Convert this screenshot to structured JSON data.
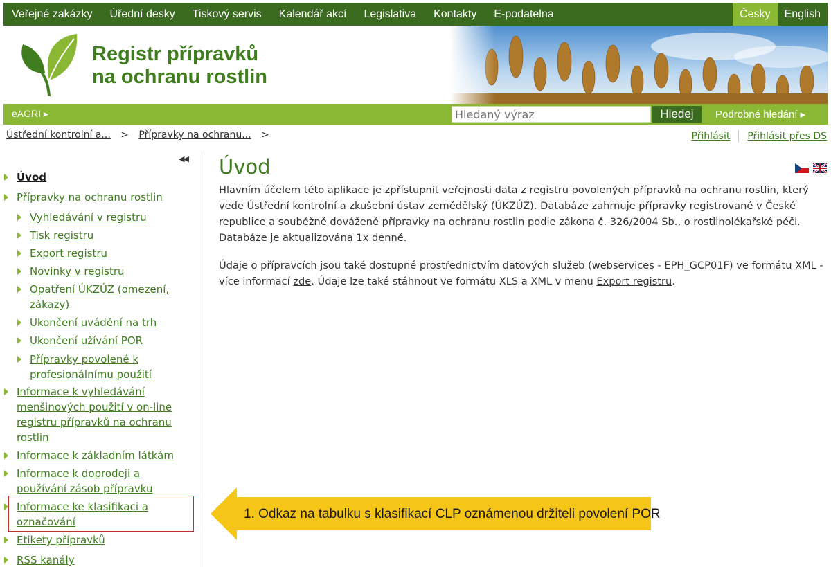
{
  "topnav": {
    "items": [
      "Veřejné zakázky",
      "Úřední desky",
      "Tiskový servis",
      "Kalendář akcí",
      "Legislativa",
      "Kontakty",
      "E-podatelna"
    ],
    "lang_cs": "Česky",
    "lang_en": "English"
  },
  "header": {
    "brand_line1": "Registr přípravků",
    "brand_line2": "na ochranu rostlin"
  },
  "greenbar": {
    "eagri": "eAGRI",
    "search_placeholder": "Hledaný výraz",
    "search_button": "Hledej",
    "advanced": "Podrobné hledání"
  },
  "breadcrumb": {
    "item1": "Ústřední kontrolní a...",
    "item2": "Přípravky na ochranu...",
    "sep": ">"
  },
  "login": {
    "login": "Přihlásit",
    "login_ds": "Přihlásit přes DS"
  },
  "sidebar": {
    "uvod": "Úvod",
    "pripravky": "Přípravky na ochranu rostlin",
    "sub": [
      "Vyhledávání v registru",
      "Tisk registru",
      "Export registru",
      "Novinky v registru",
      "Opatření ÚKZÚZ (omezení, zákazy)",
      "Ukončení uvádění na trh",
      "Ukončení užívání POR",
      "Přípravky povolené k profesionálnímu použití"
    ],
    "info_mensin": "Informace k vyhledávání menšinových použití v on-line registru přípravků na ochranu rostlin",
    "info_latky": "Informace k základním látkám",
    "info_doprodej": "Informace k doprodeji a používání zásob přípravku",
    "info_klasifikace": "Informace ke klasifikaci a označování",
    "etikety": "Etikety přípravků",
    "rss": "RSS kanály"
  },
  "main": {
    "title": "Úvod",
    "p1": "Hlavním účelem této aplikace je zpřístupnit veřejnosti data z registru povolených přípravků na ochranu rostlin, který vede Ústřední kontrolní a zkušební ústav zemědělský (ÚKZÚZ). Databáze zahrnuje přípravky registrované v České republice a souběžně dovážené přípravky na ochranu rostlin podle zákona č. 326/2004 Sb., o rostlinolékařské péči. Databáze je aktualizována 1x denně.",
    "p2_a": "Údaje o přípravcích jsou také dostupné prostřednictvím datových služeb (webservices - EPH_GCP01F) ve formátu XML - více informací ",
    "p2_link1": "zde",
    "p2_b": ". Údaje lze také stáhnout ve formátu XLS a XML v menu ",
    "p2_link2": "Export registru",
    "p2_c": "."
  },
  "callout": {
    "text": "1. Odkaz na tabulku s klasifikací CLP oznámenou držiteli povolení POR"
  },
  "colors": {
    "dark_green": "#3a6b1f",
    "light_green": "#8ab834",
    "link_green": "#3f7d1e",
    "callout_yellow": "#f5c518",
    "highlight_red": "#c0312b"
  }
}
